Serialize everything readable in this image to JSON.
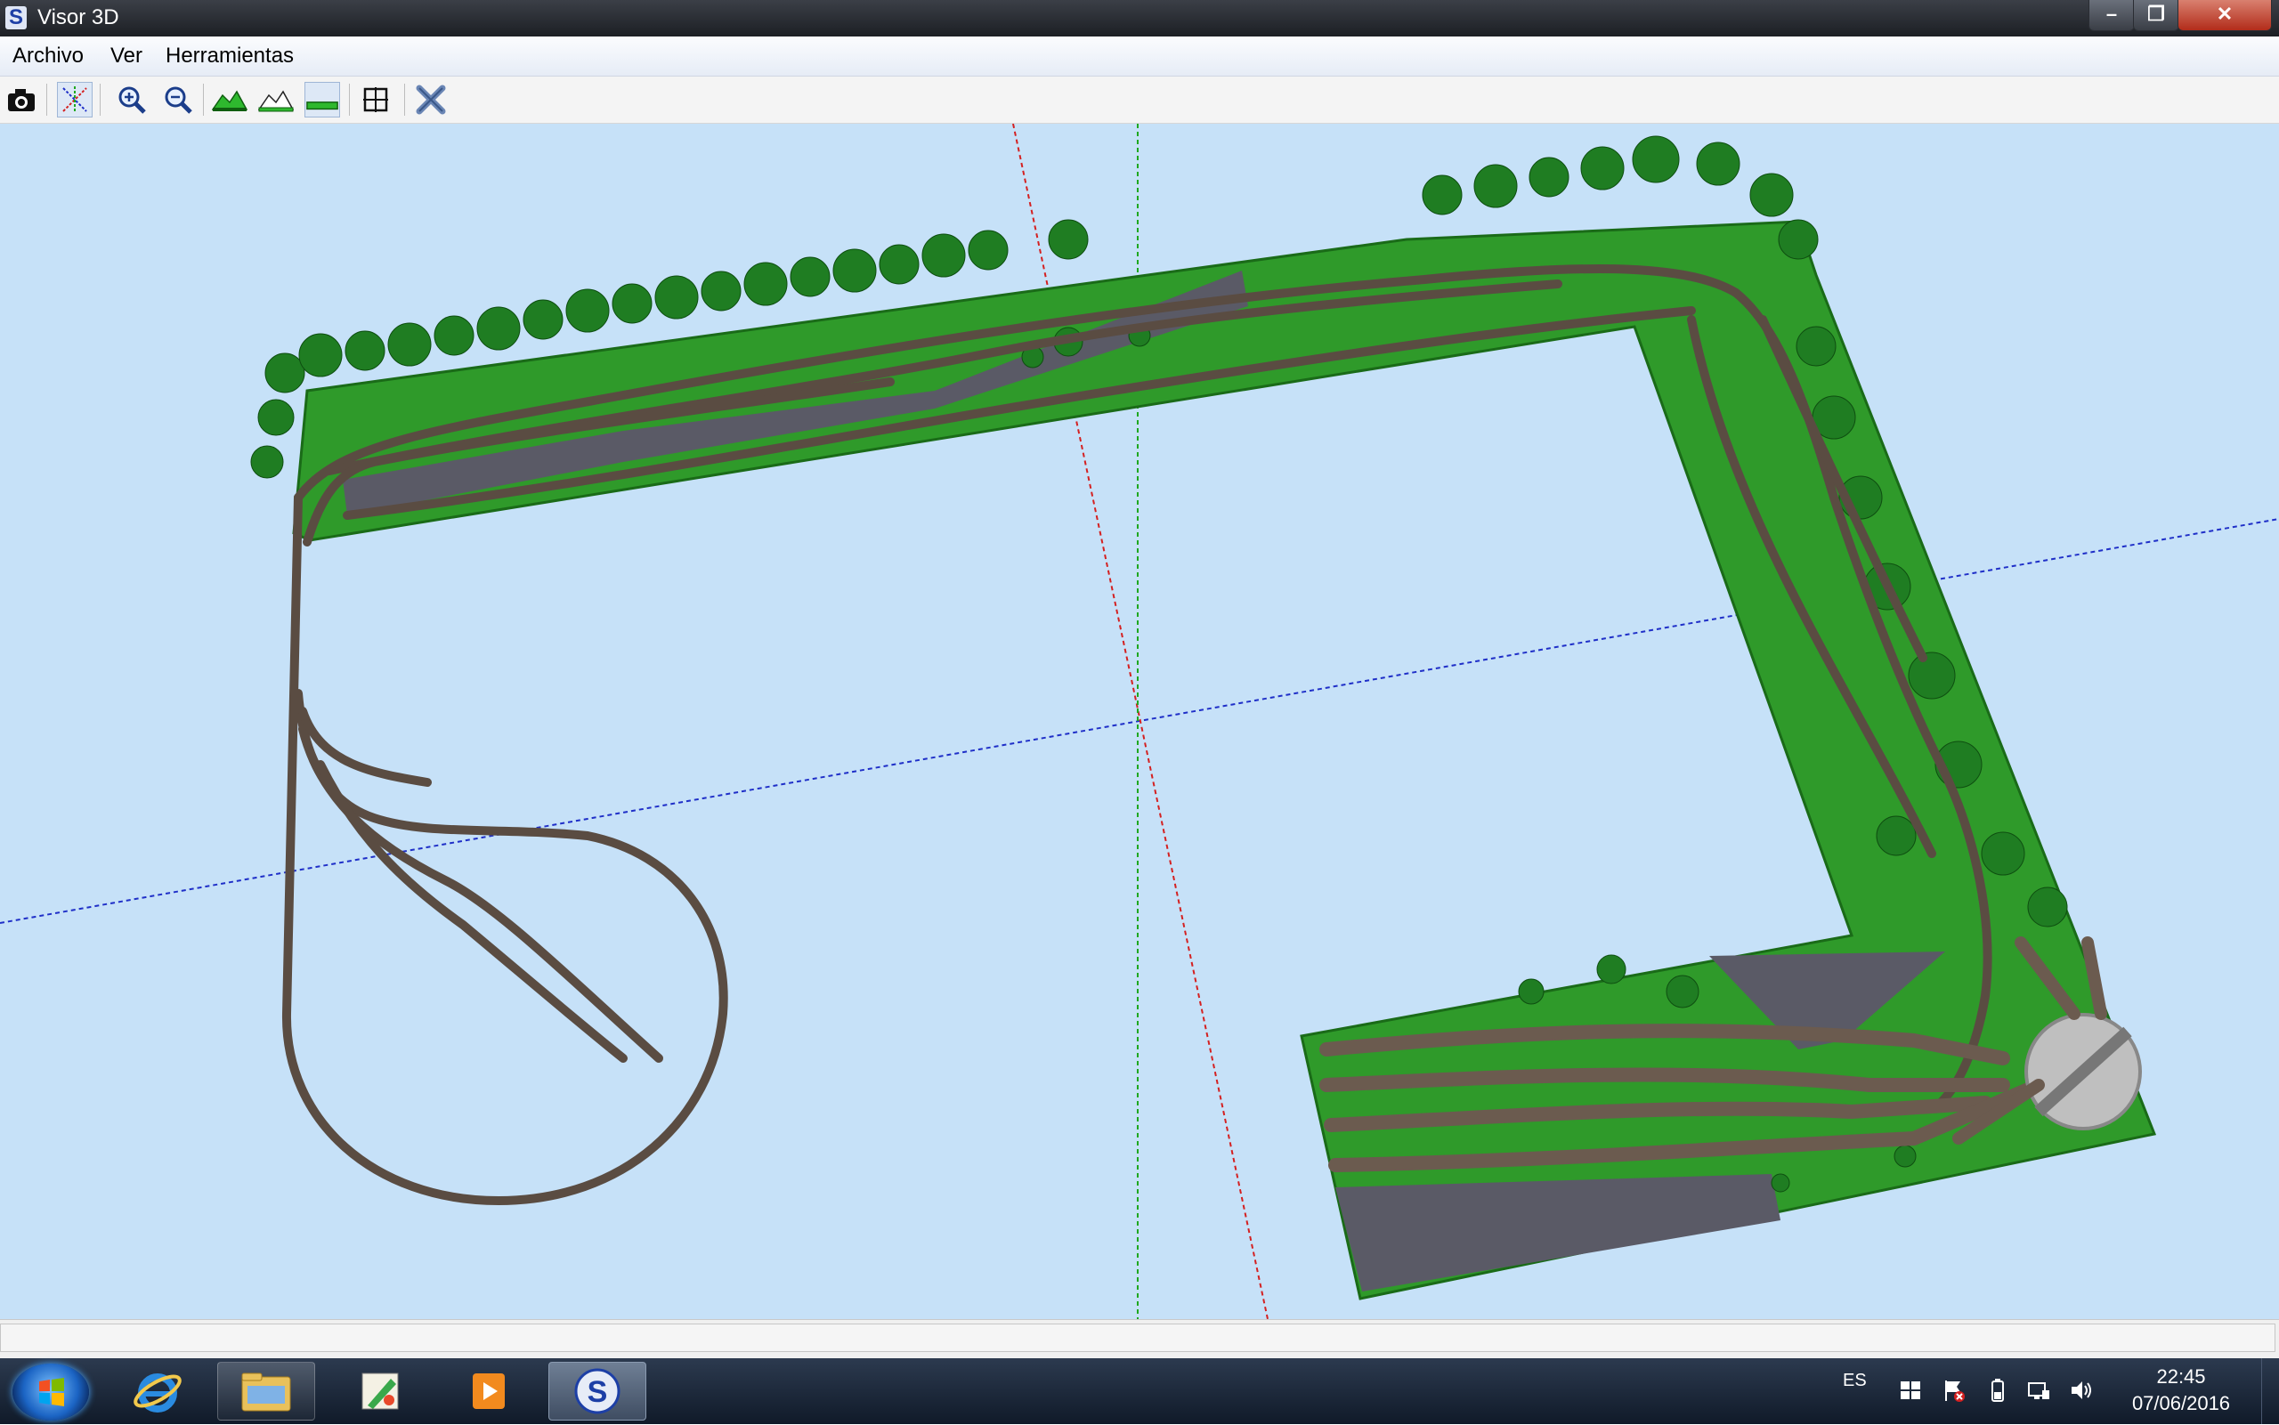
{
  "window": {
    "app_icon_letter": "S",
    "title": "Visor 3D",
    "min_glyph": "–",
    "max_glyph": "❐",
    "close_glyph": "✕"
  },
  "menu": {
    "items": [
      "Archivo",
      "Ver",
      "Herramientas"
    ]
  },
  "toolbar": {
    "tools": [
      {
        "name": "camera-icon",
        "pressed": false
      },
      {
        "name": "axes-icon",
        "pressed": true
      },
      {
        "name": "zoom-in-icon",
        "pressed": false
      },
      {
        "name": "zoom-out-icon",
        "pressed": false
      },
      {
        "name": "terrain-icon",
        "pressed": false
      },
      {
        "name": "terrain-outline-icon",
        "pressed": false
      },
      {
        "name": "flat-terrain-icon",
        "pressed": true
      },
      {
        "name": "fit-view-icon",
        "pressed": false
      },
      {
        "name": "close-view-icon",
        "pressed": false
      }
    ]
  },
  "viewport": {
    "background": "#c6e1f8",
    "ground_color": "#2f9a2a",
    "track_color": "#5a4c42",
    "road_color": "#5a5a66",
    "axis_x_color": "#d42020",
    "axis_y_color": "#1fa81f",
    "axis_z_color": "#1f2fc8"
  },
  "status": {
    "text": ""
  },
  "taskbar": {
    "apps": [
      "internet-explorer-icon",
      "file-explorer-icon",
      "paint-icon",
      "media-player-icon",
      "visor-app-icon"
    ],
    "active_app": "visor-app-icon",
    "tray_lang": "ES",
    "time": "22:45",
    "date": "07/06/2016"
  }
}
